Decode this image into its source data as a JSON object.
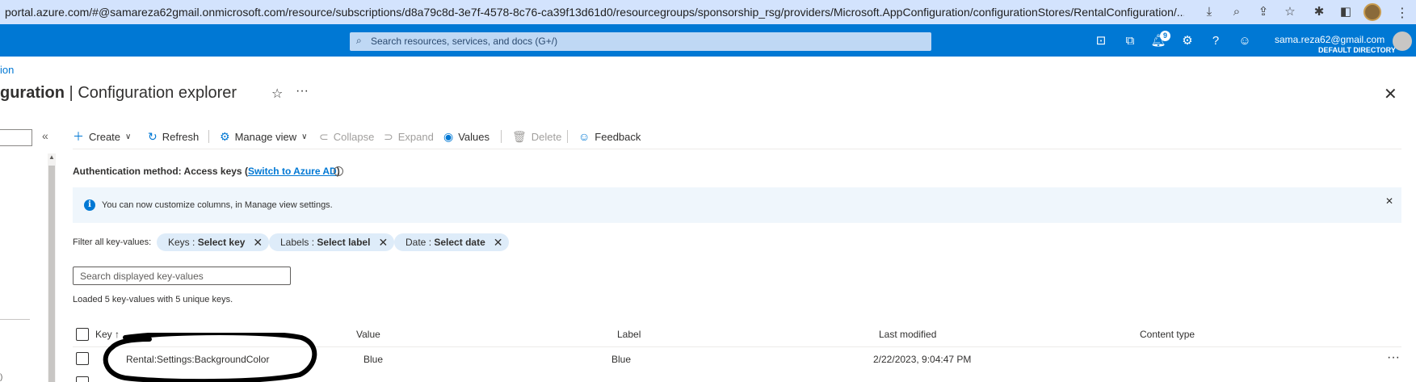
{
  "browser": {
    "url": "portal.azure.com/#@samareza62gmail.onmicrosoft.com/resource/subscriptions/d8a79c8d-3e7f-4578-8c76-ca39f13d61d0/resourcegroups/sponsorship_rsg/providers/Microsoft.AppConfiguration/configurationStores/RentalConfiguration/..."
  },
  "topbar": {
    "search_placeholder": "Search resources, services, and docs (G+/)",
    "notification_count": "9",
    "user_email": "sama.reza62@gmail.com",
    "user_directory": "DEFAULT DIRECTORY"
  },
  "breadcrumb": "ion",
  "page": {
    "title_bold": "guration",
    "title_sep": " | ",
    "title_rest": "Configuration explorer"
  },
  "toolbar": {
    "create": "Create",
    "refresh": "Refresh",
    "manage_view": "Manage view",
    "collapse": "Collapse",
    "expand": "Expand",
    "values": "Values",
    "delete": "Delete",
    "feedback": "Feedback"
  },
  "auth": {
    "prefix": "Authentication method: Access keys (",
    "link": "Switch to Azure AD",
    "suffix": ")"
  },
  "banner": {
    "text": "You can now customize columns, in Manage view settings."
  },
  "filters": {
    "label": "Filter all key-values:",
    "pills": [
      {
        "name": "Keys",
        "sep": " : ",
        "value": "Select key"
      },
      {
        "name": "Labels",
        "sep": " : ",
        "value": "Select label"
      },
      {
        "name": "Date",
        "sep": " : ",
        "value": "Select date"
      }
    ]
  },
  "search": {
    "placeholder": "Search displayed key-values"
  },
  "loaded_text": "Loaded 5 key-values with 5 unique keys.",
  "table": {
    "columns": {
      "key": "Key",
      "sort": "↑",
      "value": "Value",
      "label": "Label",
      "last_modified": "Last modified",
      "content_type": "Content type"
    },
    "rows": [
      {
        "key": "Rental:Settings:BackgroundColor",
        "value": "Blue",
        "label": "Blue",
        "last_modified": "2/22/2023, 9:04:47 PM",
        "content_type": ""
      }
    ]
  },
  "sidebar": {
    "fragment": ")"
  }
}
